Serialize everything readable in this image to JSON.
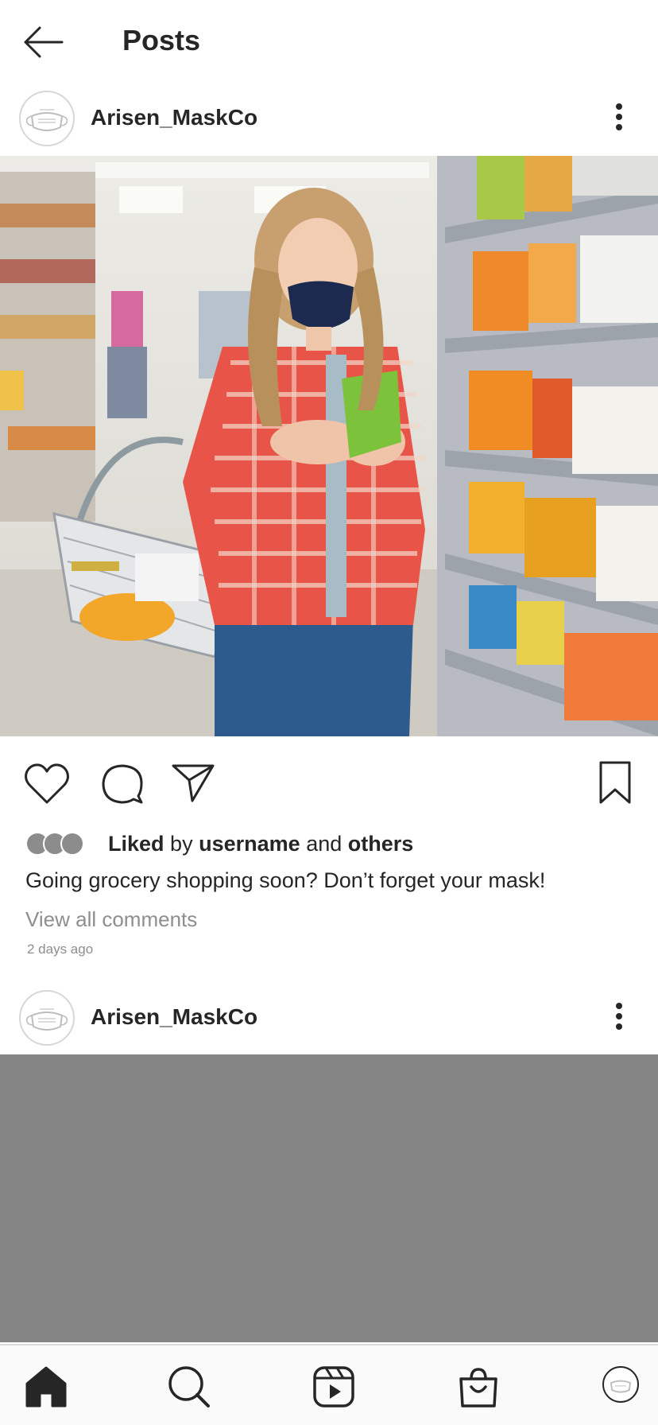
{
  "topbar": {
    "title": "Posts"
  },
  "posts": [
    {
      "username": "Arisen_MaskCo",
      "likes": {
        "liked": "Liked",
        "by": "by",
        "user": "username",
        "and": "and",
        "others": "others"
      },
      "caption": "Going grocery shopping soon? Don’t forget your mask!",
      "view_comments": "View all comments",
      "timestamp": "2 days ago"
    },
    {
      "username": "Arisen_MaskCo"
    }
  ],
  "icons": {
    "back": "arrow-left-icon",
    "more": "vertical-dots-icon",
    "like": "heart-icon",
    "comment": "comment-bubble-icon",
    "share": "paper-plane-icon",
    "save": "bookmark-icon",
    "home": "home-icon",
    "search": "search-icon",
    "reels": "reels-icon",
    "shop": "shopping-bag-icon"
  },
  "colors": {
    "text": "#262626",
    "muted": "#8e8e8e",
    "placeholder_image": "#858585"
  }
}
